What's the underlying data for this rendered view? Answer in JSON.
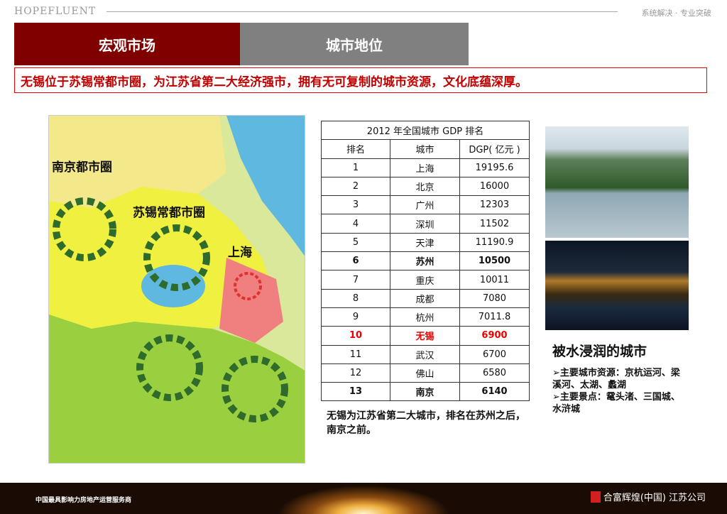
{
  "header": {
    "brand": "HOPEFLUENT",
    "slogan": "系统解决 · 专业突破"
  },
  "tabs": [
    {
      "label": "宏观市场"
    },
    {
      "label": "城市地位"
    }
  ],
  "banner": "无锡位于苏锡常都市圈，为江苏省第二大经济强市，拥有无可复制的城市资源，文化底蕴深厚。",
  "map": {
    "labels": [
      "南京都市圈",
      "苏锡常都市圈",
      "上海"
    ]
  },
  "table": {
    "title": "2012 年全国城市 GDP 排名",
    "headers": [
      "排名",
      "城市",
      "DGP( 亿元 )"
    ],
    "rows": [
      [
        "1",
        "上海",
        "19195.6"
      ],
      [
        "2",
        "北京",
        "16000"
      ],
      [
        "3",
        "广州",
        "12303"
      ],
      [
        "4",
        "深圳",
        "11502"
      ],
      [
        "5",
        "天津",
        "11190.9"
      ],
      [
        "6",
        "苏州",
        "10500"
      ],
      [
        "7",
        "重庆",
        "10011"
      ],
      [
        "8",
        "成都",
        "7080"
      ],
      [
        "9",
        "杭州",
        "7011.8"
      ],
      [
        "10",
        "无锡",
        "6900"
      ],
      [
        "11",
        "武汉",
        "6700"
      ],
      [
        "12",
        "佛山",
        "6580"
      ],
      [
        "13",
        "南京",
        "6140"
      ]
    ]
  },
  "caption": "无锡为江苏省第二大城市，排名在苏州之后，南京之前。",
  "side": {
    "subtitle": "被水浸润的城市",
    "bullets": [
      "主要城市资源：京杭运河、梁溪河、太湖、蠡湖",
      "主要景点：鼋头渚、三国城、水浒城"
    ]
  },
  "footer": {
    "tagline": "中国最具影响力房地产运营服务商",
    "company": "合富辉煌(中国)",
    "branch": "江苏公司"
  },
  "colors": {
    "accent": "#800000",
    "tab_inactive": "#808080",
    "highlight": "#e00000"
  }
}
